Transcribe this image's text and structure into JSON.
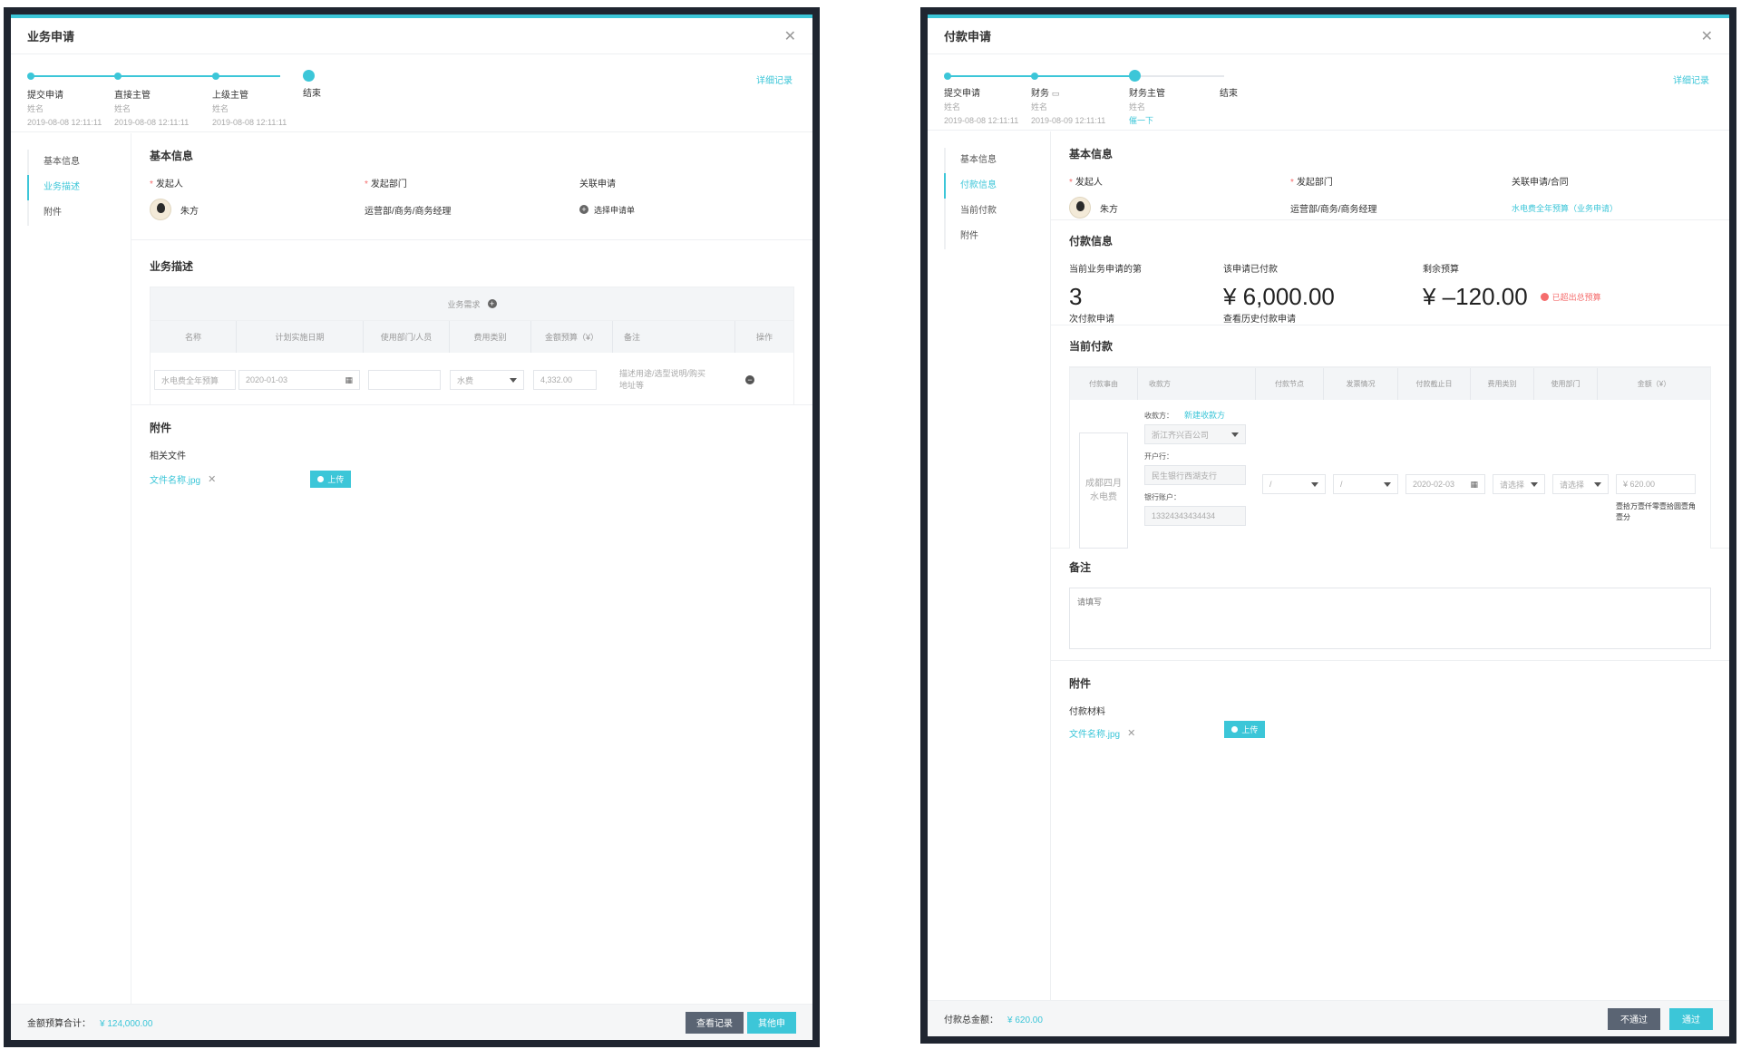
{
  "left": {
    "title": "业务申请",
    "detail_link": "详细记录",
    "steps": [
      {
        "name": "提交申请",
        "sub": "姓名",
        "time": "2019-08-08 12:11:11"
      },
      {
        "name": "直接主管",
        "sub": "姓名",
        "time": "2019-08-08 12:11:11"
      },
      {
        "name": "上级主管",
        "sub": "姓名",
        "time": "2019-08-08 12:11:11"
      },
      {
        "name": "结束"
      }
    ],
    "nav": [
      "基本信息",
      "业务描述",
      "附件"
    ],
    "basic": {
      "title": "基本信息",
      "initiator_label": "发起人",
      "initiator": "朱方",
      "dept_label": "发起部门",
      "dept": "运营部/商务/商务经理",
      "related_label": "关联申请",
      "related_action": "选择申请单"
    },
    "desc": {
      "title": "业务描述",
      "table_caption": "业务需求",
      "headers": [
        "名称",
        "计划实施日期",
        "使用部门/人员",
        "费用类别",
        "金额预算（¥）",
        "备注",
        "操作"
      ],
      "row": {
        "name": "水电费全年预算",
        "date": "2020-01-03",
        "dept": "",
        "category": "水费",
        "amount": "4,332.00",
        "remark": "描述用途/选型说明/购买地址等"
      }
    },
    "attach": {
      "title": "附件",
      "label": "相关文件",
      "file": "文件名称.jpg",
      "upload": "上传"
    },
    "footer": {
      "total_label": "金额预算合计：",
      "total": "¥ 124,000.00",
      "btn_records": "查看记录",
      "btn_other": "其他申"
    }
  },
  "right": {
    "title": "付款申请",
    "detail_link": "详细记录",
    "steps": [
      {
        "name": "提交申请",
        "sub": "姓名",
        "time": "2019-08-08 12:11:11"
      },
      {
        "name": "财务",
        "sub": "姓名",
        "time": "2019-08-09 12:11:11"
      },
      {
        "name": "财务主管",
        "sub": "姓名",
        "action": "催一下"
      },
      {
        "name": "结束"
      }
    ],
    "nav": [
      "基本信息",
      "付款信息",
      "当前付款",
      "附件"
    ],
    "basic": {
      "title": "基本信息",
      "initiator_label": "发起人",
      "initiator": "朱方",
      "dept_label": "发起部门",
      "dept": "运营部/商务/商务经理",
      "related_label": "关联申请/合同",
      "related": "水电费全年预算（业务申请）"
    },
    "payinfo": {
      "title": "付款信息",
      "count_label": "当前业务申请的第",
      "count": "3",
      "count_sub": "次付款申请",
      "paid_label": "该申请已付款",
      "paid": "¥ 6,000.00",
      "paid_link": "查看历史付款申请",
      "remain_label": "剩余预算",
      "remain": "¥ –120.00",
      "warning": "已超出总预算"
    },
    "current": {
      "title": "当前付款",
      "headers": [
        "付款事由",
        "收款方",
        "付款节点",
        "发票情况",
        "付款截止日",
        "费用类别",
        "使用部门",
        "金额（¥）"
      ],
      "reason": "成都四月水电费",
      "payee_label": "收款方：",
      "new_payee": "新建收款方",
      "payee": "浙江齐兴百公司",
      "bank_label": "开户行：",
      "bank": "民生银行西湖支行",
      "account_label": "银行账户：",
      "account": "13324343434434",
      "node": "/",
      "invoice": "/",
      "deadline": "2020-02-03",
      "category": "请选择",
      "dept": "请选择",
      "amount": "¥ 620.00",
      "amount_words": "壹拾万壹仟零壹拾圆壹角壹分"
    },
    "remark": {
      "title": "备注",
      "placeholder": "请填写"
    },
    "attach": {
      "title": "附件",
      "label": "付款材料",
      "file": "文件名称.jpg",
      "upload": "上传"
    },
    "footer": {
      "total_label": "付款总金额：",
      "total": "¥ 620.00",
      "btn_reject": "不通过",
      "btn_pass": "通过"
    }
  },
  "colors": {
    "accent": "#3cc6d8",
    "danger": "#f56c6c",
    "frame": "#1f2530"
  },
  "icons": [
    "close-icon",
    "plus-circle-icon",
    "minus-circle-icon",
    "calendar-icon",
    "chevron-down-icon",
    "upload-icon",
    "message-icon",
    "warning-icon"
  ]
}
